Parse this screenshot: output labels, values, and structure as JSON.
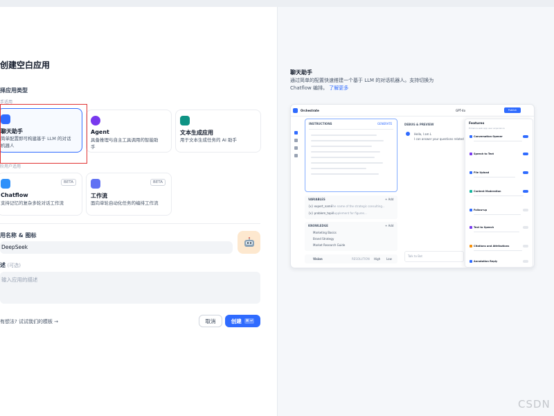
{
  "dialog": {
    "title": "创建空白应用",
    "type_section": "择应用类型",
    "sub_for_beginners": "手适用",
    "sub_for_advanced": "阶用户适用",
    "cards": [
      {
        "name": "聊天助手",
        "desc1": "简单配置即可构建基于 LLM 的对话",
        "desc2": "机器人",
        "selected": true
      },
      {
        "name": "Agent",
        "desc1": "具备推理与自主工具调用的智能助",
        "desc2": "手"
      },
      {
        "name": "文本生成应用",
        "desc1": "用于文本生成任务的 AI 助手",
        "desc2": ""
      },
      {
        "name": "Chatflow",
        "desc1": "支持记忆的复杂多轮对话工作流",
        "desc2": "",
        "badge": "BETA"
      },
      {
        "name": "工作流",
        "desc1": "面向单轮自动化任务的编排工作流",
        "desc2": "",
        "badge": "BETA"
      }
    ],
    "name_label": "用名称 & 图标",
    "name_value": "DeepSeek",
    "desc_label": "述",
    "desc_optional": "(可选)",
    "desc_placeholder": "输入应用的描述",
    "template_link": "有想法? 试试我们的模板 →",
    "cancel": "取消",
    "create": "创建",
    "create_shortcut": "⌘ ↵"
  },
  "preview": {
    "title": "聊天助手",
    "desc_line1": "通过简单的配置快速搭建一个基于 LLM 的对话机器人。支持切换为",
    "desc_line2": "Chatflow 编排。",
    "learn_more": "了解更多",
    "app_name": "Orchestrate",
    "model": "GPT-4o",
    "publish": "Publish",
    "instructions": "INSTRUCTIONS",
    "generate": "GENERATE",
    "debug": "DEBUG & PREVIEW",
    "variables": "VARIABLES",
    "add": "+ Add",
    "var_rows": [
      {
        "key": "{x} expert_name",
        "desc": "The name of the strategic consulting..."
      },
      {
        "key": "{x} problem_topic",
        "desc": "Supplement for figures..."
      }
    ],
    "knowledge": "KNOWLEDGE",
    "kb_rows": [
      "Marketing Basics",
      "Brand Strategy",
      "Market Research Guide"
    ],
    "vision": "Vision",
    "resolution": "RESOLUTION",
    "high": "High",
    "low": "Low",
    "chat_hello": "Hello, I am L",
    "chat_answer": "I can answer your questions related",
    "features_title": "Features",
    "features_sub": "Enhance web app user experience",
    "features": [
      {
        "name": "Conversation Opener",
        "color": "#2f6bff"
      },
      {
        "name": "Speech to Text",
        "color": "#7839ee"
      },
      {
        "name": "File Upload",
        "color": "#2f6bff"
      },
      {
        "name": "Content Moderation",
        "color": "#15b79e"
      },
      {
        "name": "Follow-up",
        "color": "#2f6bff"
      },
      {
        "name": "Text to Speech",
        "color": "#7839ee"
      },
      {
        "name": "Citations and Attributions",
        "color": "#f79009"
      },
      {
        "name": "Annotation Reply",
        "color": "#2f6bff"
      }
    ],
    "talk_placeholder": "Talk to Bot"
  },
  "watermark": "CSDN",
  "colors": {
    "accent": "#2f6bff",
    "red_highlight": "#e03131",
    "chat": "#2f6bff",
    "agent": "#7839ee",
    "text_gen": "#0e9384",
    "chatflow": "#2e90fa",
    "workflow": "#6172f3",
    "emoji_bg": "#fde8cf"
  }
}
